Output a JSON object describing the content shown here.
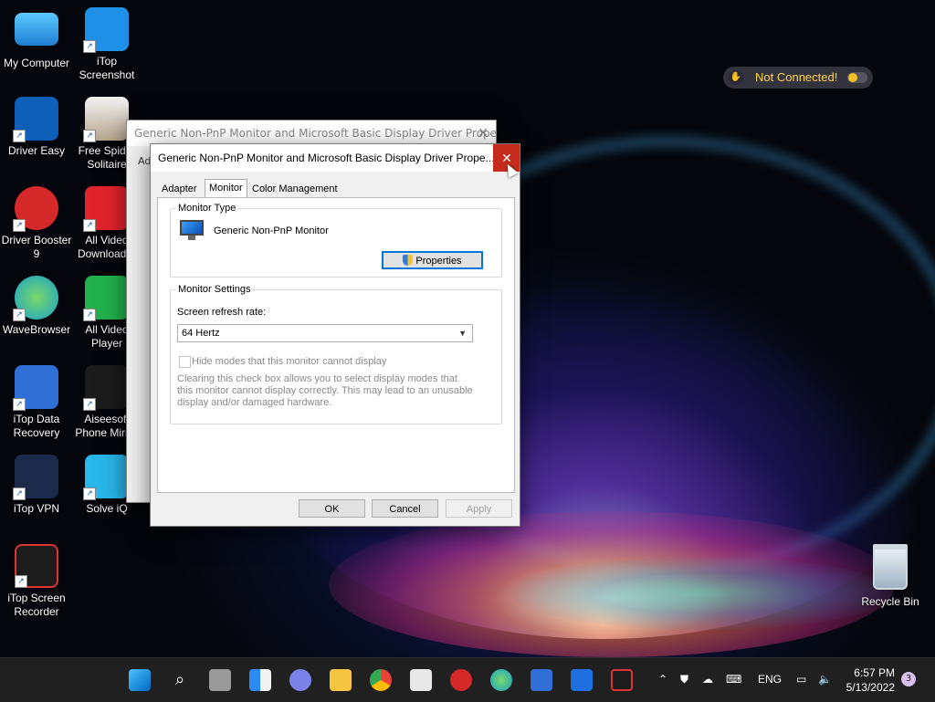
{
  "desktop": {
    "icons": [
      {
        "label": "My Computer",
        "icon": "computer-icon",
        "color": "#35a6e8"
      },
      {
        "label": "iTop Screenshot",
        "icon": "camera-icon",
        "color": "#1e90e8"
      },
      {
        "label": "Driver Easy",
        "icon": "driver-easy-icon",
        "color": "#0d5fb8"
      },
      {
        "label": "Free Spider Solitaire",
        "icon": "spider-icon",
        "color": "#e8e8e8"
      },
      {
        "label": "Driver Booster 9",
        "icon": "driver-booster-icon",
        "color": "#d62a2a"
      },
      {
        "label": "All Video Downloader",
        "icon": "download-icon",
        "color": "#e0242b"
      },
      {
        "label": "WaveBrowser",
        "icon": "wave-browser-icon",
        "color": "#18b48a"
      },
      {
        "label": "All Video Player",
        "icon": "play-icon",
        "color": "#22b14c"
      },
      {
        "label": "iTop Data Recovery",
        "icon": "data-recovery-icon",
        "color": "#2f6fd6"
      },
      {
        "label": "Aiseesoft Phone Mirror",
        "icon": "phone-mirror-icon",
        "color": "#1b1b1b"
      },
      {
        "label": "iTop VPN",
        "icon": "vpn-shield-icon",
        "color": "#1f6fe0"
      },
      {
        "label": "Solve iQ",
        "icon": "solve-iq-icon",
        "color": "#29b6e8"
      },
      {
        "label": "iTop Screen Recorder",
        "icon": "screen-recorder-icon",
        "color": "#e03434"
      }
    ],
    "recycle_bin": "Recycle Bin"
  },
  "vpn_widget": {
    "text": "Not Connected!",
    "status_color": "#f4c022"
  },
  "back_window": {
    "title": "Generic Non-PnP Monitor and Microsoft Basic Display Driver Prope...",
    "tab_stub": "Ad"
  },
  "dialog": {
    "title": "Generic Non-PnP Monitor and Microsoft Basic Display Driver Prope...",
    "close_glyph": "✕",
    "tabs": [
      "Adapter",
      "Monitor",
      "Color Management"
    ],
    "monitor_type": {
      "legend": "Monitor Type",
      "name": "Generic Non-PnP Monitor",
      "properties_button": "Properties"
    },
    "monitor_settings": {
      "legend": "Monitor Settings",
      "refresh_label": "Screen refresh rate:",
      "refresh_value": "64 Hertz",
      "hide_modes_label": "Hide modes that this monitor cannot display",
      "hide_modes_checked": false,
      "help_text": "Clearing this check box allows you to select display modes that this monitor cannot display correctly. This may lead to an unusable display and/or damaged hardware."
    },
    "buttons": {
      "ok": "OK",
      "cancel": "Cancel",
      "apply": "Apply"
    }
  },
  "taskbar": {
    "items": [
      "start-icon",
      "search-icon",
      "task-view-icon",
      "widgets-icon",
      "chat-icon",
      "file-explorer-icon",
      "chrome-icon",
      "store-icon",
      "driver-booster-icon",
      "wave-browser-icon",
      "data-recovery-icon",
      "vpn-shield-icon",
      "screen-recorder-icon"
    ],
    "tray": {
      "language": "ENG"
    },
    "clock": {
      "time": "6:57 PM",
      "date": "5/13/2022"
    },
    "notification_count": "3"
  }
}
